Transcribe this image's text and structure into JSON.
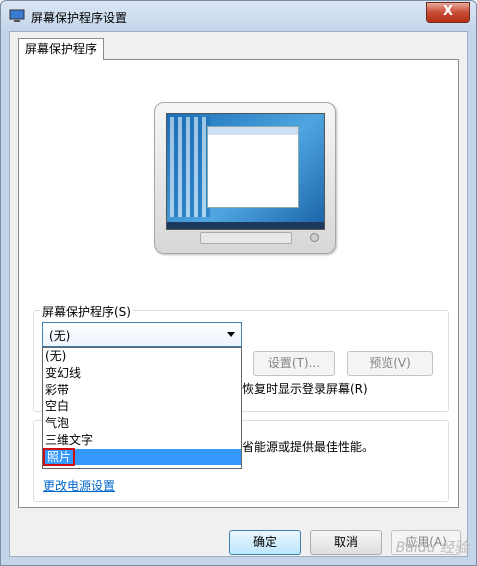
{
  "window": {
    "title": "屏幕保护程序设置",
    "close_label": "X"
  },
  "tabs": [
    {
      "label": "屏幕保护程序"
    }
  ],
  "screensaver": {
    "group_label": "屏幕保护程序(S)",
    "selected_value": "(无)",
    "settings_button": "设置(T)...",
    "preview_button": "预览(V)",
    "resume_text": "恢复时显示登录屏幕(R)",
    "options": [
      "(无)",
      "变幻线",
      "彩带",
      "空白",
      "气泡",
      "三维文字",
      "照片"
    ],
    "highlighted_index": 6
  },
  "power": {
    "description_fragment": "省能源或提供最佳性能。",
    "link_text": "更改电源设置"
  },
  "footer": {
    "ok_button": "确定",
    "cancel_button": "取消",
    "apply_button": "应用(A)"
  },
  "watermark": "Baidu 经验"
}
